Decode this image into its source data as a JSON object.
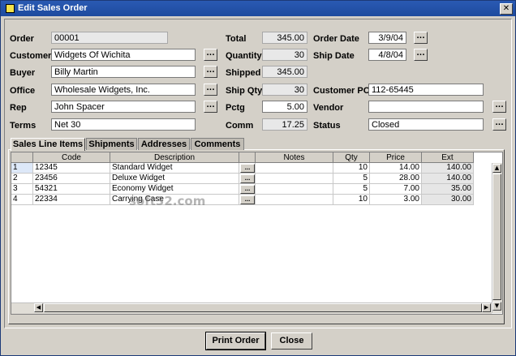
{
  "window": {
    "title": "Edit Sales Order",
    "close_glyph": "✕"
  },
  "labels": {
    "order": "Order",
    "customer": "Customer",
    "buyer": "Buyer",
    "office": "Office",
    "rep": "Rep",
    "terms": "Terms",
    "total": "Total",
    "quantity": "Quantity",
    "shipped": "Shipped",
    "ship_qty": "Ship Qty",
    "pctg": "Pctg",
    "comm": "Comm",
    "order_date": "Order Date",
    "ship_date": "Ship Date",
    "customer_po": "Customer PO",
    "vendor": "Vendor",
    "status": "Status"
  },
  "fields": {
    "order": "00001",
    "customer": "Widgets Of Wichita",
    "buyer": "Billy Martin",
    "office": "Wholesale Widgets, Inc.",
    "rep": "John Spacer",
    "terms": "Net 30",
    "total": "345.00",
    "quantity": "30",
    "shipped": "345.00",
    "ship_qty": "30",
    "pctg": "5.00",
    "comm": "17.25",
    "order_date": "3/9/04",
    "ship_date": "4/8/04",
    "customer_po": "112-65445",
    "vendor": "",
    "status": "Closed"
  },
  "ellipsis": "...",
  "tabs": [
    "Sales Line Items",
    "Shipments",
    "Addresses",
    "Comments"
  ],
  "grid": {
    "headers": [
      "",
      "Code",
      "Description",
      "",
      "Notes",
      "Qty",
      "Price",
      "Ext"
    ],
    "rows": [
      {
        "num": "1",
        "code": "12345",
        "description": "Standard Widget",
        "notes": "",
        "qty": "10",
        "price": "14.00",
        "ext": "140.00"
      },
      {
        "num": "2",
        "code": "23456",
        "description": "Deluxe Widget",
        "notes": "",
        "qty": "5",
        "price": "28.00",
        "ext": "140.00"
      },
      {
        "num": "3",
        "code": "54321",
        "description": "Economy Widget",
        "notes": "",
        "qty": "5",
        "price": "7.00",
        "ext": "35.00"
      },
      {
        "num": "4",
        "code": "22334",
        "description": "Carrying Case",
        "notes": "",
        "qty": "10",
        "price": "3.00",
        "ext": "30.00"
      }
    ]
  },
  "scroll_glyphs": {
    "up": "▲",
    "down": "▼",
    "left": "◀",
    "right": "▶"
  },
  "watermark": "soft32.com",
  "buttons": {
    "print": "Print Order",
    "close": "Close"
  }
}
